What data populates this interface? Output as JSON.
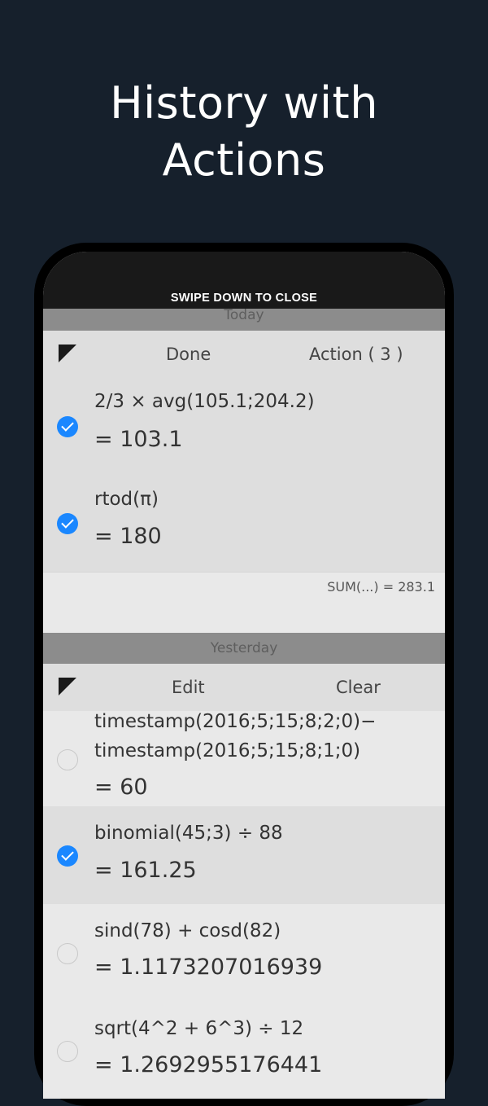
{
  "headline": {
    "line1": "History with",
    "line2": "Actions"
  },
  "banner": {
    "swipe_text": "SWIPE DOWN TO CLOSE"
  },
  "today": {
    "label": "Today",
    "toolbar": {
      "done_label": "Done",
      "action_label": "Action ( 3 )"
    },
    "entries": [
      {
        "expr": "2/3 × avg(105.1;204.2)",
        "result": "= 103.1",
        "selected": true
      },
      {
        "expr": "rtod(π)",
        "result": "= 180",
        "selected": true
      }
    ],
    "sum": "SUM(...) = 283.1"
  },
  "yesterday": {
    "label": "Yesterday",
    "toolbar": {
      "edit_label": "Edit",
      "clear_label": "Clear"
    },
    "entries": [
      {
        "expr_line1": "timestamp(2016;5;15;8;2;0)−",
        "expr_line2": "timestamp(2016;5;15;8;1;0)",
        "result": "= 60",
        "selected": false
      },
      {
        "expr": "binomial(45;3) ÷ 88",
        "result": "= 161.25",
        "selected": true
      },
      {
        "expr": "sind(78) + cosd(82)",
        "result": "= 1.1173207016939",
        "selected": false
      },
      {
        "expr": "sqrt(4^2 + 6^3) ÷ 12",
        "result": "= 1.2692955176441",
        "selected": false
      }
    ]
  },
  "colors": {
    "accent": "#1a87ff",
    "background": "#16202c"
  },
  "icons": {
    "corner": "corner-triangle-icon",
    "check": "checkmark-icon"
  }
}
